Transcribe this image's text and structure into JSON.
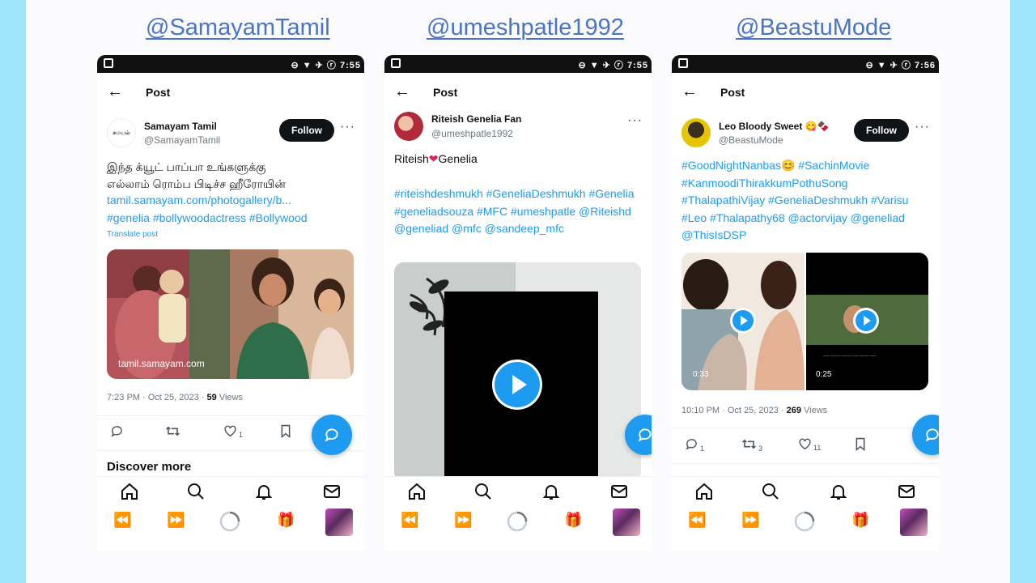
{
  "panels": [
    {
      "handle": "@SamayamTamil",
      "status_right": "⊖ ▼ ✈ ⓡ 7:55",
      "topbar": {
        "title": "Post"
      },
      "author": {
        "name": "Samayam Tamil",
        "handle": "@SamayamTamil",
        "follow_label": "Follow",
        "avatar_text": "சமயம்"
      },
      "post": {
        "text_line1": "இந்த க்யூட் பாப்பா உங்களுக்கு",
        "text_line2": "எல்லாம் ரொம்ப பிடிச்ச ஹீரோயின்",
        "link": "tamil.samayam.com/photogallery/b...",
        "tags": "#genelia #bollywoodactress #Bollywood",
        "translate": "Translate post",
        "image_watermark": "tamil.samayam.com"
      },
      "meta": {
        "time": "7:23 PM · Oct 25, 2023 · ",
        "views_count": "59",
        "views_label": " Views"
      },
      "actions": {
        "like_count": "1"
      },
      "discover": "Discover more"
    },
    {
      "handle": "@umeshpatle1992",
      "status_right": "⊖ ▼ ✈ ⓡ 7:55",
      "topbar": {
        "title": "Post"
      },
      "author": {
        "name": "Riteish Genelia Fan",
        "handle": "@umeshpatle1992"
      },
      "post": {
        "text_prefix": "Riteish",
        "text_suffix": "Genelia",
        "tags": "#riteishdeshmukh #GeneliaDeshmukh #Genelia #geneliadsouza #MFC #umeshpatle @Riteishd @geneliad @mfc @sandeep_mfc"
      }
    },
    {
      "handle": "@BeastuMode",
      "status_right": "⊖ ▼ ✈ ⓡ 7:56",
      "topbar": {
        "title": "Post"
      },
      "author": {
        "name": "Leo Bloody Sweet 😋🍫",
        "handle": "@BeastuMode",
        "follow_label": "Follow"
      },
      "post": {
        "tags": "#GoodNightNanbas😊 #SachinMovie #KanmoodiThirakkumPothuSong #ThalapathiVijay #GeneliaDeshmukh #Varisu #Leo #Thalapathy68 @actorvijay @geneliad @ThisIsDSP",
        "video1_duration": "0:33",
        "video2_duration": "0:25"
      },
      "meta": {
        "time": "10:10 PM · Oct 25, 2023 · ",
        "views_count": "269",
        "views_label": " Views"
      },
      "actions": {
        "reply_count": "1",
        "repost_count": "3",
        "like_count": "11"
      }
    }
  ],
  "icons": {
    "back": "back-arrow-icon",
    "more": "more-dots-icon",
    "home": "home-icon",
    "search": "search-icon",
    "notifications": "bell-icon",
    "messages": "mail-icon"
  },
  "colors": {
    "accent": "#1d9bf0",
    "handle_link": "#4a74c6",
    "background_frame": "#9ee7fb"
  }
}
